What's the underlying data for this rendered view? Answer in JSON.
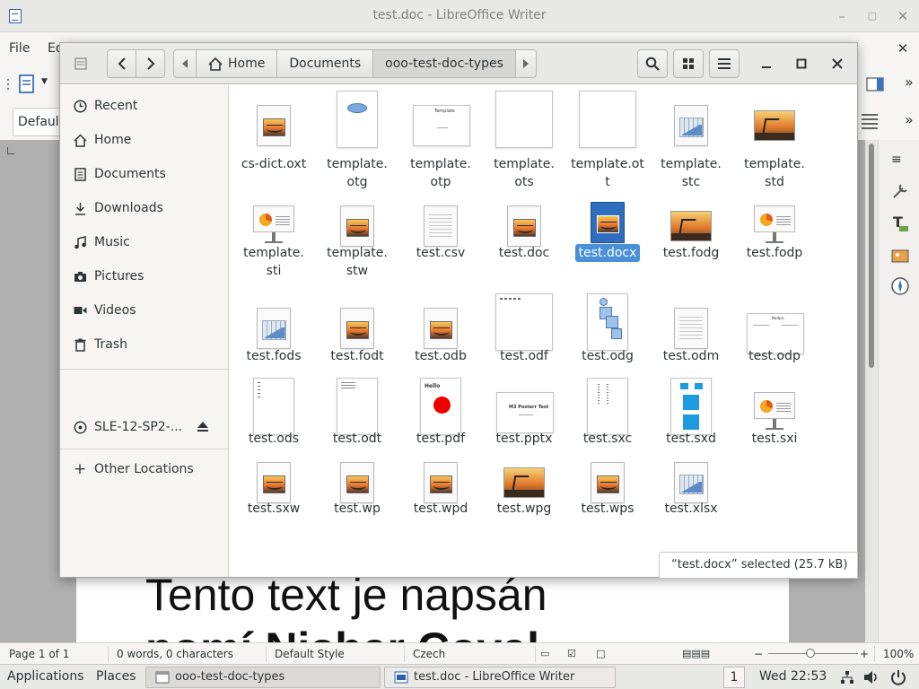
{
  "writer": {
    "window_title": "test.doc - LibreOffice Writer",
    "menu": [
      "File",
      "Ed"
    ],
    "paragraph_style": "Default",
    "document_text": [
      "Tento text je napsán",
      "pomí Nishar Coval"
    ],
    "status": {
      "page": "Page 1 of 1",
      "words": "0 words, 0 characters",
      "style": "Default Style",
      "language": "Czech",
      "zoom": "100%"
    }
  },
  "dialog": {
    "breadcrumb": [
      "Home",
      "Documents",
      "ooo-test-doc-types"
    ],
    "places": [
      "Recent",
      "Home",
      "Documents",
      "Downloads",
      "Music",
      "Pictures",
      "Videos",
      "Trash"
    ],
    "volume": "SLE-12-SP2-...",
    "other_locations": "Other Locations",
    "files": [
      {
        "name": "cs-dict.oxt",
        "icon": "document-image"
      },
      {
        "name": "template.otg",
        "icon": "drawing-preview"
      },
      {
        "name": "template.otp",
        "icon": "presentation-preview"
      },
      {
        "name": "template.ots",
        "icon": "blank-preview"
      },
      {
        "name": "template.ott",
        "icon": "blank-preview"
      },
      {
        "name": "template.stc",
        "icon": "spreadsheet"
      },
      {
        "name": "template.std",
        "icon": "photo"
      },
      {
        "name": "template.sti",
        "icon": "presentation"
      },
      {
        "name": "template.stw",
        "icon": "document-image"
      },
      {
        "name": "test.csv",
        "icon": "text"
      },
      {
        "name": "test.doc",
        "icon": "document-image"
      },
      {
        "name": "test.docx",
        "icon": "document-blue",
        "selected": true
      },
      {
        "name": "test.fodg",
        "icon": "photo"
      },
      {
        "name": "test.fodp",
        "icon": "presentation"
      },
      {
        "name": "test.fods",
        "icon": "spreadsheet"
      },
      {
        "name": "test.fodt",
        "icon": "document-image"
      },
      {
        "name": "test.odb",
        "icon": "document-image"
      },
      {
        "name": "test.odf",
        "icon": "formula-preview"
      },
      {
        "name": "test.odg",
        "icon": "shapes-preview"
      },
      {
        "name": "test.odm",
        "icon": "text"
      },
      {
        "name": "test.odp",
        "icon": "slide-preview"
      },
      {
        "name": "test.ods",
        "icon": "sheet-preview"
      },
      {
        "name": "test.odt",
        "icon": "page-preview"
      },
      {
        "name": "test.pdf",
        "icon": "hello-preview"
      },
      {
        "name": "test.pptx",
        "icon": "pptx-preview"
      },
      {
        "name": "test.sxc",
        "icon": "vertical-preview"
      },
      {
        "name": "test.sxd",
        "icon": "squares-preview"
      },
      {
        "name": "test.sxi",
        "icon": "presentation"
      },
      {
        "name": "test.sxw",
        "icon": "document-image"
      },
      {
        "name": "test.wp",
        "icon": "document-image"
      },
      {
        "name": "test.wpd",
        "icon": "document-image"
      },
      {
        "name": "test.wpg",
        "icon": "photo"
      },
      {
        "name": "test.wps",
        "icon": "document-image"
      },
      {
        "name": "test.xlsx",
        "icon": "spreadsheet"
      }
    ],
    "preview_text": {
      "template_otp": "Template",
      "pdf_hello": "Hello",
      "pptx_title": "M3 Posterr Test",
      "odp_title": "Nadpis"
    },
    "selection_status": "“test.docx” selected  (25.7 kB)",
    "colors": {
      "selection": "#4a90d9"
    }
  },
  "panel": {
    "applications": "Applications",
    "places": "Places",
    "task1": "ooo-test-doc-types",
    "task2": "test.doc - LibreOffice Writer",
    "workspace": "1",
    "clock": "Wed 22:53"
  }
}
